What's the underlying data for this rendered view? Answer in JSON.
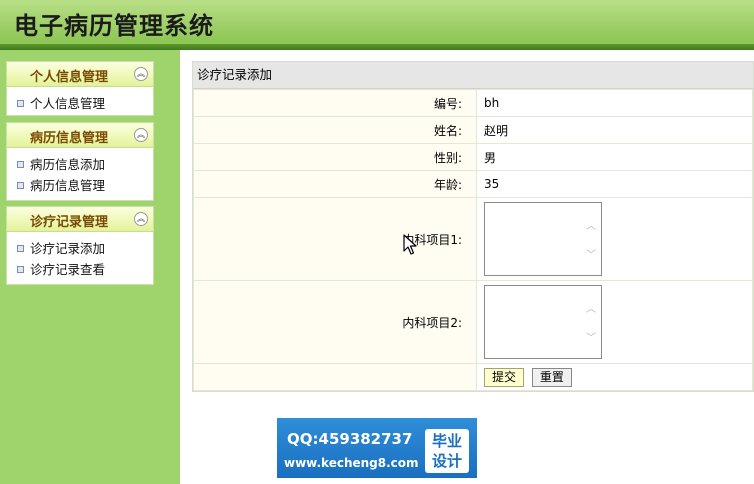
{
  "header": {
    "title": "电子病历管理系统"
  },
  "sidebar": {
    "panels": [
      {
        "title": "个人信息管理",
        "items": [
          "个人信息管理"
        ]
      },
      {
        "title": "病历信息管理",
        "items": [
          "病历信息添加",
          "病历信息管理"
        ]
      },
      {
        "title": "诊疗记录管理",
        "items": [
          "诊疗记录添加",
          "诊疗记录查看"
        ]
      }
    ]
  },
  "form": {
    "caption": "诊疗记录添加",
    "fields": [
      {
        "label": "编号:",
        "value": "bh"
      },
      {
        "label": "姓名:",
        "value": "赵明"
      },
      {
        "label": "性别:",
        "value": "男"
      },
      {
        "label": "年龄:",
        "value": "35"
      },
      {
        "label": "内科项目1:",
        "value": ""
      },
      {
        "label": "内科项目2:",
        "value": ""
      }
    ],
    "submit_label": "提交",
    "reset_label": "重置"
  },
  "watermark": {
    "qq": "QQ:459382737",
    "site": "www.kecheng8.com",
    "badge_line1": "毕业",
    "badge_line2": "设计"
  }
}
